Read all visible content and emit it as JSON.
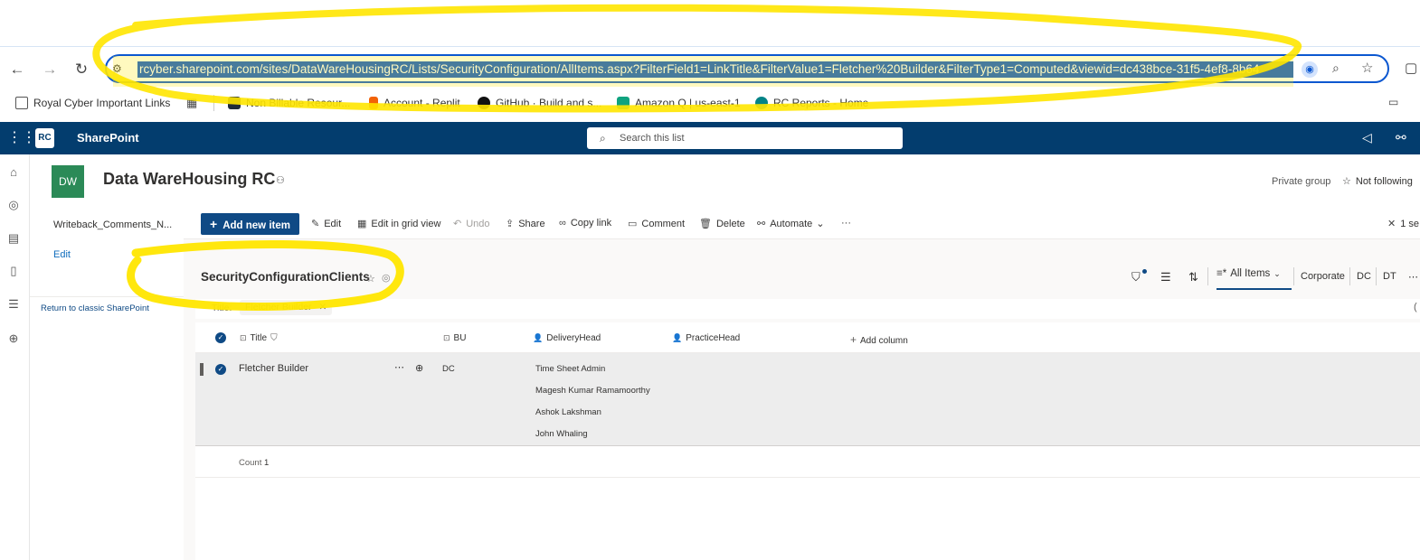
{
  "browser": {
    "url": "rcyber.sharepoint.com/sites/DataWareHousingRC/Lists/SecurityConfiguration/AllItems.aspx?FilterField1=LinkTitle&FilterValue1=Fletcher%20Builder&FilterType1=Computed&viewid=dc438bce-31f5-4ef8-8b64",
    "bookmarks": [
      {
        "label": "Royal Cyber Important Links",
        "icon": "folder-icon"
      },
      {
        "label": "Non Billable Resour...",
        "icon": "react-icon"
      },
      {
        "label": "Account - Replit",
        "icon": "replit-icon"
      },
      {
        "label": "GitHub · Build and s...",
        "icon": "github-icon"
      },
      {
        "label": "Amazon Q | us-east-1",
        "icon": "amazon-q-icon"
      },
      {
        "label": "RC Reports - Home",
        "icon": "sharepoint-icon"
      }
    ]
  },
  "suite": {
    "app_name": "SharePoint",
    "logo_text": "RC",
    "search_placeholder": "Search this list"
  },
  "site": {
    "tile": "DW",
    "title": "Data WareHousing RC",
    "privacy": "Private group",
    "follow_label": "Not following"
  },
  "leftnav": {
    "items": [
      "Writeback_Comments_N..."
    ],
    "edit": "Edit",
    "classic": "Return to classic SharePoint"
  },
  "commands": {
    "add": "Add new item",
    "edit": "Edit",
    "grid": "Edit in grid view",
    "undo": "Undo",
    "share": "Share",
    "copy_link": "Copy link",
    "comment": "Comment",
    "delete": "Delete",
    "automate": "Automate",
    "more": "···",
    "selected": "1 se"
  },
  "list": {
    "title": "SecurityConfigurationClients",
    "views": {
      "current": "All Items",
      "others": [
        "Corporate",
        "DC",
        "DT"
      ]
    },
    "filter": {
      "label": "Title:",
      "value": "Fletcher Builder"
    },
    "columns": [
      "Title",
      "BU",
      "DeliveryHead",
      "PracticeHead",
      "Add column"
    ],
    "rows": [
      {
        "title": "Fletcher Builder",
        "bu": "DC",
        "delivery_head": [
          "Time Sheet Admin",
          "Magesh Kumar Ramamoorthy",
          "Ashok Lakshman",
          "John Whaling"
        ],
        "practice_head": ""
      }
    ],
    "count_label": "Count",
    "count_value": "1"
  },
  "colors": {
    "suite_bar": "#033d6e",
    "accent": "#0f4a85",
    "site_tile": "#2b8a57",
    "highlight": "#ffe600"
  }
}
